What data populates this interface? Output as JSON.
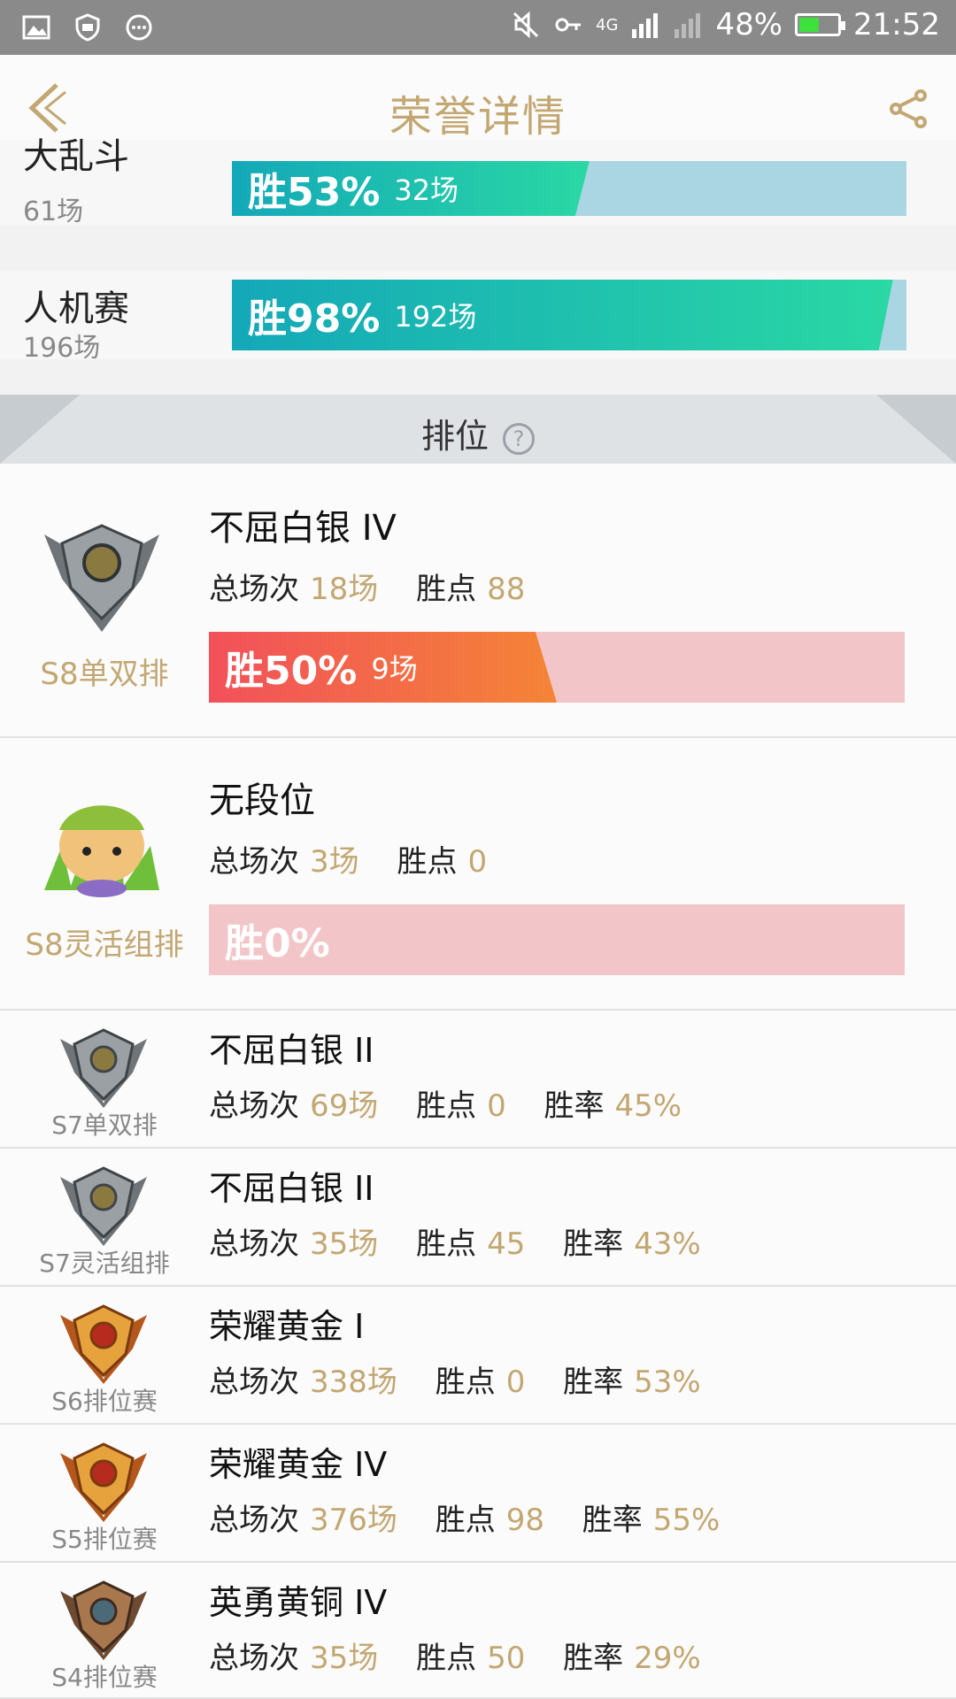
{
  "status_bar": {
    "network": "4G",
    "battery": "48%",
    "time": "21:52"
  },
  "header": {
    "title": "荣誉详情"
  },
  "modes": [
    {
      "name": "大乱斗",
      "count": "61场",
      "win_pct": "胜53%",
      "games": "32场",
      "fill": 0.53
    },
    {
      "name": "人机赛",
      "count": "196场",
      "win_pct": "胜98%",
      "games": "192场",
      "fill": 0.98
    }
  ],
  "ranked_section": {
    "label": "排位"
  },
  "labels": {
    "total": "总场次",
    "points": "胜点",
    "winrate": "胜率"
  },
  "current_ranks": [
    {
      "season": "S8单双排",
      "tier": "不屈白银 IV",
      "total": "18场",
      "points": "88",
      "win_pct": "胜50%",
      "games": "9场",
      "fill": 0.5
    },
    {
      "season": "S8灵活组排",
      "tier": "无段位",
      "total": "3场",
      "points": "0",
      "win_pct": "胜0%",
      "games": "",
      "fill": 0
    }
  ],
  "history": [
    {
      "season": "S7单双排",
      "tier": "不屈白银 II",
      "total": "69场",
      "points": "0",
      "winrate": "45%",
      "emblem": "silver"
    },
    {
      "season": "S7灵活组排",
      "tier": "不屈白银 II",
      "total": "35场",
      "points": "45",
      "winrate": "43%",
      "emblem": "silver"
    },
    {
      "season": "S6排位赛",
      "tier": "荣耀黄金 I",
      "total": "338场",
      "points": "0",
      "winrate": "53%",
      "emblem": "gold"
    },
    {
      "season": "S5排位赛",
      "tier": "荣耀黄金 IV",
      "total": "376场",
      "points": "98",
      "winrate": "55%",
      "emblem": "gold"
    },
    {
      "season": "S4排位赛",
      "tier": "英勇黄铜 IV",
      "total": "35场",
      "points": "50",
      "winrate": "29%",
      "emblem": "bronze"
    }
  ],
  "colors": {
    "accent": "#c2a772",
    "teal": "#1ab8b0",
    "red": "#f2505a"
  }
}
